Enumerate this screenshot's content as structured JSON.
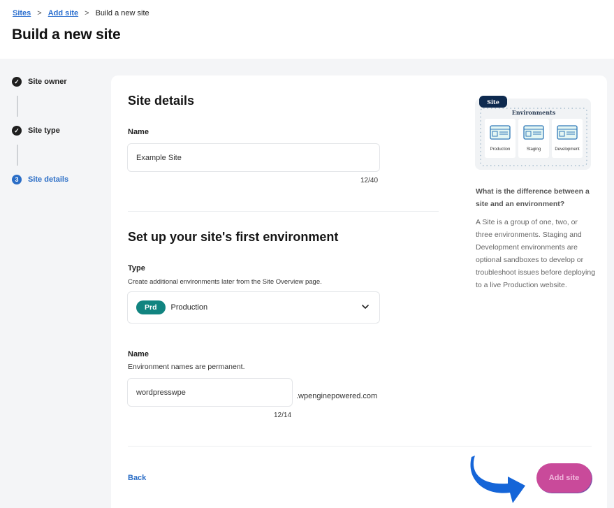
{
  "breadcrumb": {
    "items": [
      {
        "label": "Sites",
        "link": true
      },
      {
        "label": "Add site",
        "link": true
      },
      {
        "label": "Build a new site",
        "link": false
      }
    ],
    "separator": ">"
  },
  "page_title": "Build a new site",
  "stepper": {
    "steps": [
      {
        "label": "Site owner",
        "state": "complete",
        "marker": "✓"
      },
      {
        "label": "Site type",
        "state": "complete",
        "marker": "✓"
      },
      {
        "label": "Site details",
        "state": "active",
        "marker": "3"
      }
    ]
  },
  "site_details": {
    "title": "Site details",
    "name_label": "Name",
    "name_value": "Example Site",
    "name_counter": "12/40"
  },
  "environment": {
    "title": "Set up your site's first environment",
    "type_label": "Type",
    "type_helper": "Create additional environments later from the Site Overview page.",
    "type_badge": "Prd",
    "type_value": "Production",
    "name_label": "Name",
    "name_helper": "Environment names are permanent.",
    "name_value": "wordpresswpe",
    "name_suffix": ".wpenginepowered.com",
    "name_counter": "12/14"
  },
  "footer": {
    "back_label": "Back",
    "submit_label": "Add site"
  },
  "aside": {
    "illustration": {
      "site_tag": "Site",
      "heading": "Environments",
      "envs": [
        "Production",
        "Staging",
        "Development"
      ]
    },
    "question": "What is the difference between a site and an environment?",
    "answer": "A Site is a group of one, two, or three environments. Staging and Development environments are optional sandboxes to develop or troubleshoot issues before deploying to a live Production website."
  },
  "colors": {
    "link_blue": "#2a6dc6",
    "badge_teal": "#118480",
    "submit_pink": "#c94a9a",
    "annotation_arrow": "#1565d8",
    "illustration_navy": "#0e2a4f"
  }
}
